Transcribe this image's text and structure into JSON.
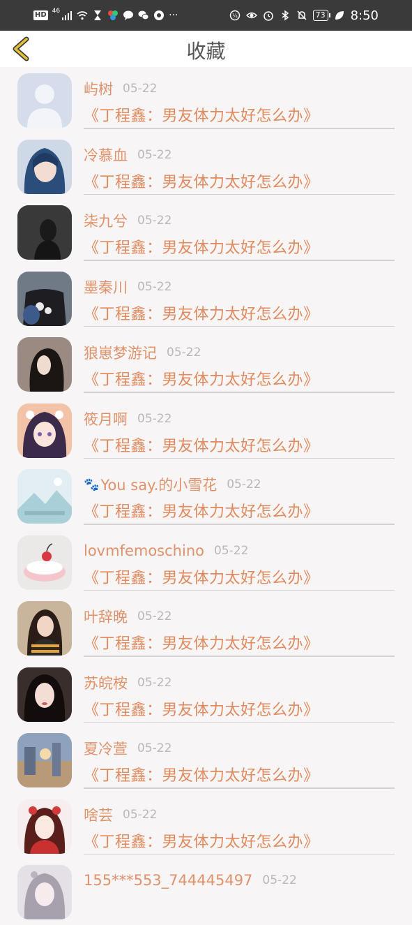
{
  "status_bar": {
    "left_badge": "HD",
    "network": "46",
    "more": "···",
    "battery": "73",
    "time": "8:50"
  },
  "header": {
    "title": "收藏"
  },
  "items": [
    {
      "name": "屿树",
      "date": "05-22",
      "title": "《丁程鑫：男友体力太好怎么办》"
    },
    {
      "name": "冷慕血",
      "date": "05-22",
      "title": "《丁程鑫：男友体力太好怎么办》"
    },
    {
      "name": "柒九兮",
      "date": "05-22",
      "title": "《丁程鑫：男友体力太好怎么办》"
    },
    {
      "name": "墨秦川",
      "date": "05-22",
      "title": "《丁程鑫：男友体力太好怎么办》"
    },
    {
      "name": "狼崽梦游记",
      "date": "05-22",
      "title": "《丁程鑫：男友体力太好怎么办》"
    },
    {
      "name": "筱月啊",
      "date": "05-22",
      "title": "《丁程鑫：男友体力太好怎么办》"
    },
    {
      "name": "You say.的小雪花",
      "date": "05-22",
      "title": "《丁程鑫：男友体力太好怎么办》"
    },
    {
      "name": "lovmfemoschino",
      "date": "05-22",
      "title": "《丁程鑫：男友体力太好怎么办》"
    },
    {
      "name": "叶辞晚",
      "date": "05-22",
      "title": "《丁程鑫：男友体力太好怎么办》"
    },
    {
      "name": "苏皖桉",
      "date": "05-22",
      "title": "《丁程鑫：男友体力太好怎么办》"
    },
    {
      "name": "夏冷萱",
      "date": "05-22",
      "title": "《丁程鑫：男友体力太好怎么办》"
    },
    {
      "name": "啥芸",
      "date": "05-22",
      "title": "《丁程鑫：男友体力太好怎么办》"
    },
    {
      "name": "155***553_744445497",
      "date": "05-22",
      "title": ""
    }
  ],
  "colors": {
    "accent": "#e08a5e",
    "status_bar": "#3a3a3a",
    "date": "#b8b8b8",
    "back_icon": "#e2c13a"
  }
}
